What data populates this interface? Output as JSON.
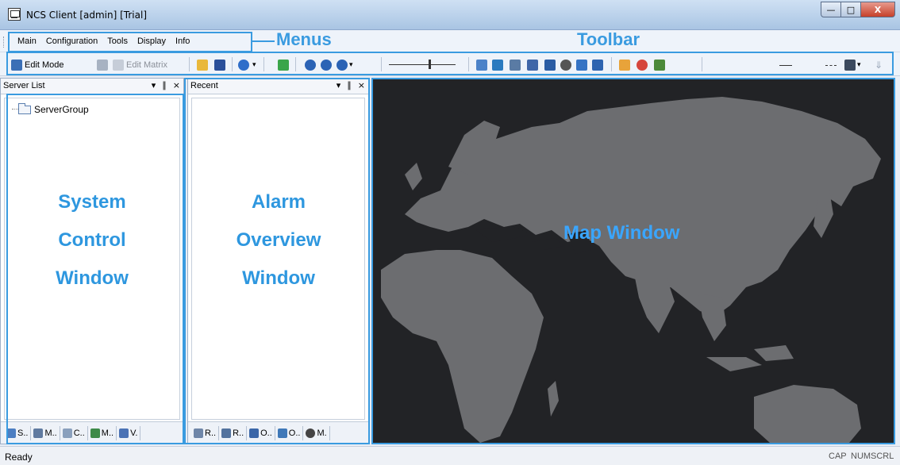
{
  "window": {
    "title": "NCS Client [admin] [Trial]",
    "controls": {
      "minimize": "—",
      "maximize": "□",
      "close": "X"
    }
  },
  "menubar": {
    "items": [
      "Main",
      "Configuration",
      "Tools",
      "Display",
      "Info"
    ]
  },
  "annotations": {
    "menus": "Menus",
    "toolbar": "Toolbar",
    "system_control": [
      "System",
      "Control",
      "Window"
    ],
    "alarm_overview": [
      "Alarm",
      "Overview",
      "Window"
    ],
    "map_window": "Map Window"
  },
  "toolbar": {
    "edit_mode": "Edit Mode",
    "edit_matrix": "Edit Matrix",
    "icons": [
      "edit-mode-icon",
      "toggle-icon",
      "edit-matrix-icon",
      "open-folder-icon",
      "save-icon",
      "help-icon",
      "pointer-icon",
      "zoom-in-icon",
      "zoom-out-icon",
      "zoom-dropdown-icon",
      "slider",
      "route-icon",
      "layers-icon",
      "grid-icon",
      "table-icon",
      "stack-icon",
      "shield-icon",
      "download-icon",
      "lock-icon",
      "folder-alarm-icon",
      "check-shield-icon",
      "approve-icon",
      "binoculars-icon",
      "arrow-down-icon"
    ]
  },
  "panels": {
    "server_list": {
      "title": "Server List",
      "tree": [
        {
          "label": "ServerGroup",
          "icon": "folder-icon"
        }
      ],
      "tabs": [
        {
          "label": "S..",
          "icon": "server-tab-icon"
        },
        {
          "label": "M..",
          "icon": "monitor-tab-icon"
        },
        {
          "label": "C..",
          "icon": "config-tab-icon"
        },
        {
          "label": "M..",
          "icon": "refresh-tab-icon"
        },
        {
          "label": "V.",
          "icon": "view-tab-icon"
        }
      ]
    },
    "recent": {
      "title": "Recent",
      "tabs": [
        {
          "label": "R..",
          "icon": "list-tab-icon"
        },
        {
          "label": "R..",
          "icon": "report-tab-icon"
        },
        {
          "label": "O..",
          "icon": "overview-tab-icon"
        },
        {
          "label": "O..",
          "icon": "columns-tab-icon"
        },
        {
          "label": "M.",
          "icon": "alert-tab-icon"
        }
      ]
    },
    "controls": {
      "dropdown": "▾",
      "pin": "∥",
      "close": "×"
    }
  },
  "statusbar": {
    "text": "Ready",
    "indicators": [
      "CAP",
      "NUM",
      "SCRL"
    ]
  },
  "colors": {
    "accent": "#3a9be0",
    "map_bg": "#222326",
    "land": "#6c6d70"
  }
}
